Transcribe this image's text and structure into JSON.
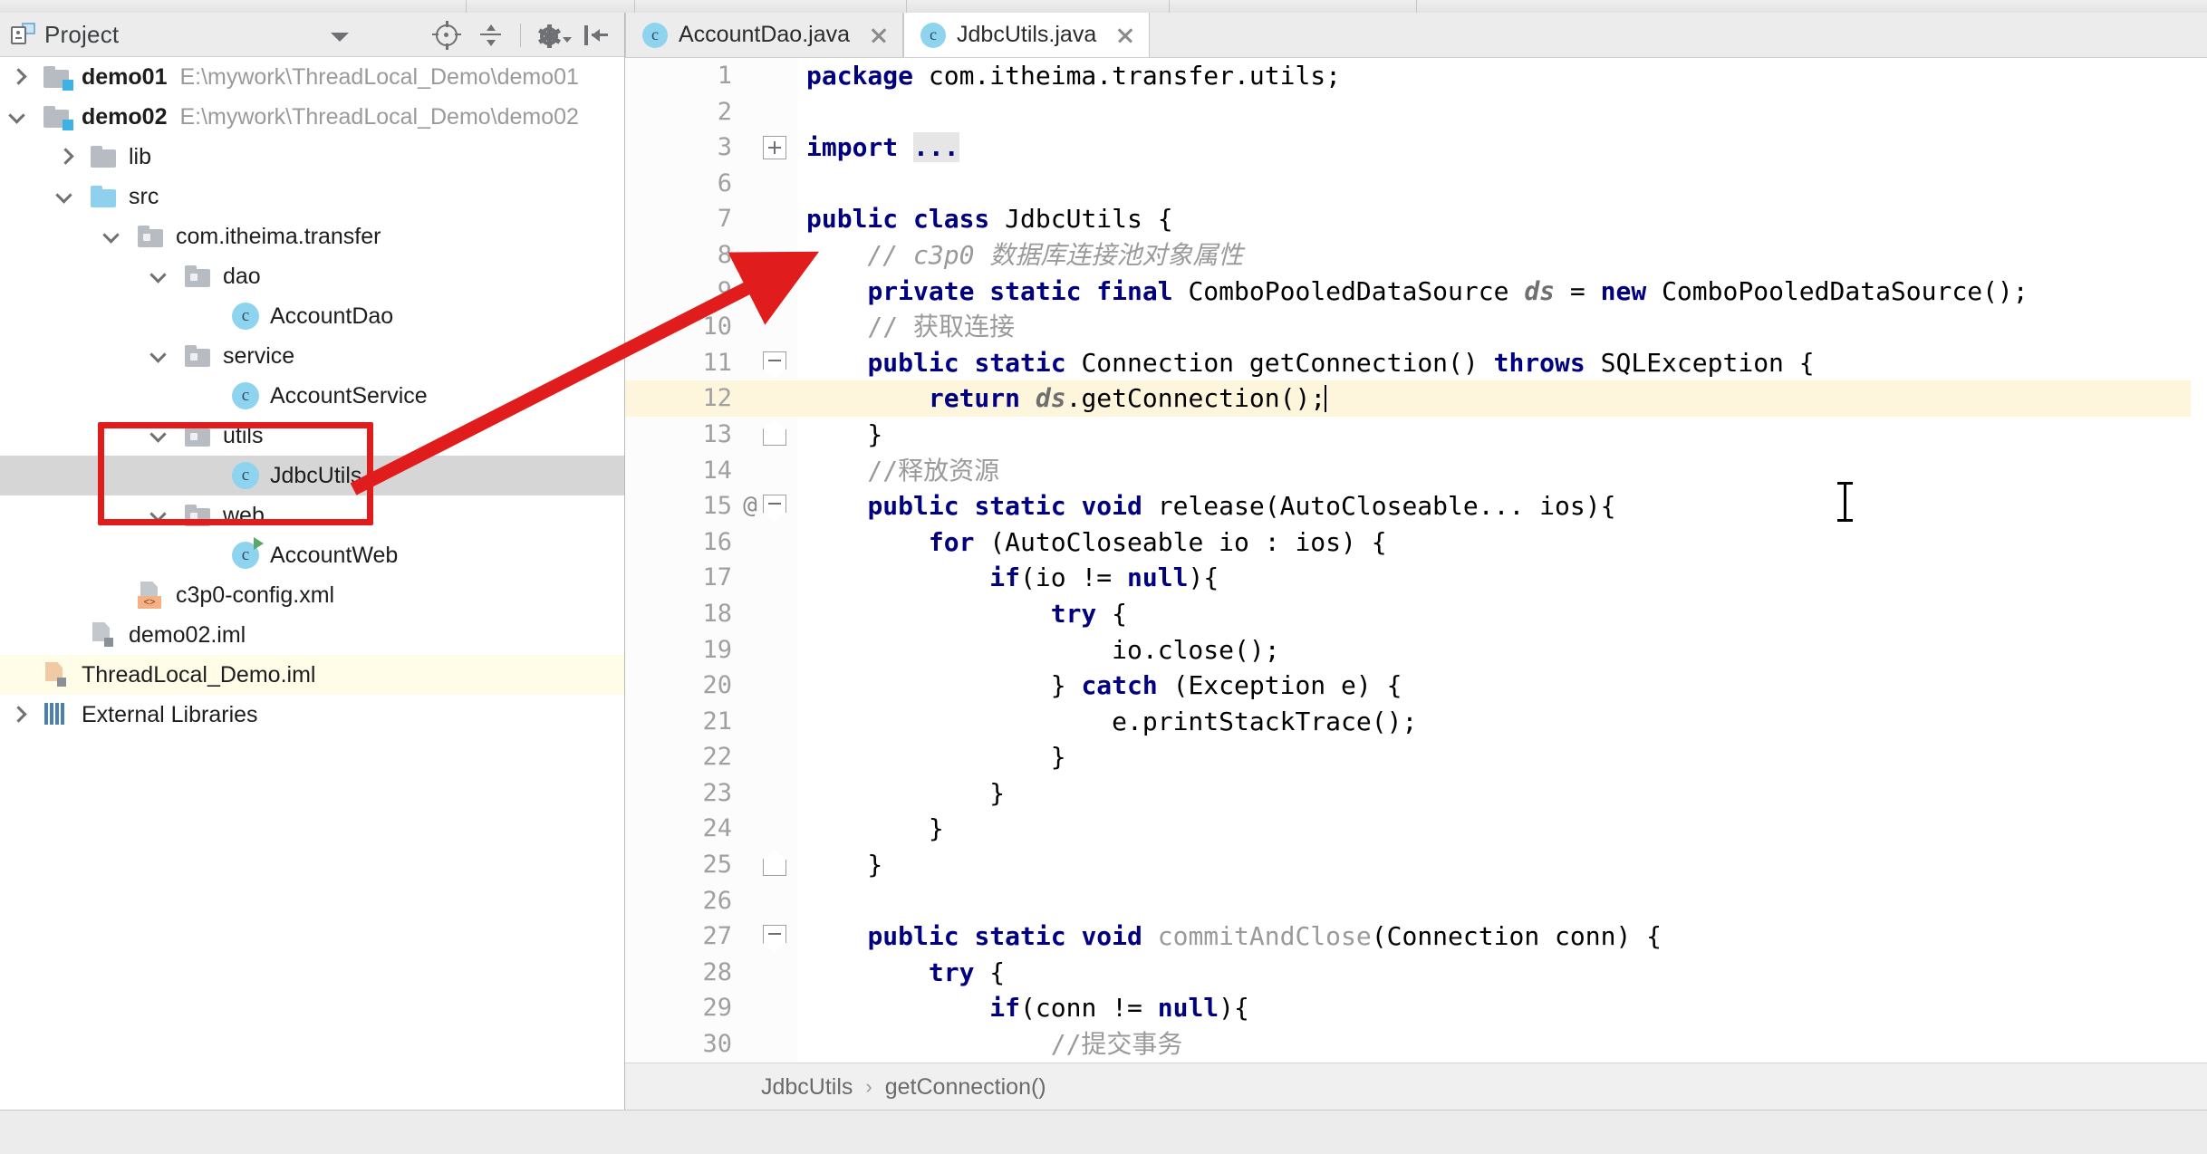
{
  "project_panel": {
    "title": "Project",
    "icons": [
      "project-icon",
      "dropdown-caret",
      "locate-icon",
      "collapse-all-icon",
      "settings-gear-icon",
      "hide-icon"
    ],
    "tree": [
      {
        "label": "demo01",
        "path": "E:\\mywork\\ThreadLocal_Demo\\demo01",
        "icon": "module-folder-icon",
        "arrow": "right",
        "indent": 0,
        "bold": true
      },
      {
        "label": "demo02",
        "path": "E:\\mywork\\ThreadLocal_Demo\\demo02",
        "icon": "module-folder-icon",
        "arrow": "down",
        "indent": 0,
        "bold": true
      },
      {
        "label": "lib",
        "path": "",
        "icon": "folder-icon",
        "arrow": "right",
        "indent": 1,
        "bold": false
      },
      {
        "label": "src",
        "path": "",
        "icon": "source-folder-icon",
        "arrow": "down",
        "indent": 1,
        "bold": false
      },
      {
        "label": "com.itheima.transfer",
        "path": "",
        "icon": "package-icon",
        "arrow": "down",
        "indent": 2,
        "bold": false
      },
      {
        "label": "dao",
        "path": "",
        "icon": "package-icon",
        "arrow": "down",
        "indent": 3,
        "bold": false
      },
      {
        "label": "AccountDao",
        "path": "",
        "icon": "java-class-icon",
        "arrow": "",
        "indent": 4,
        "bold": false
      },
      {
        "label": "service",
        "path": "",
        "icon": "package-icon",
        "arrow": "down",
        "indent": 3,
        "bold": false
      },
      {
        "label": "AccountService",
        "path": "",
        "icon": "java-class-icon",
        "arrow": "",
        "indent": 4,
        "bold": false
      },
      {
        "label": "utils",
        "path": "",
        "icon": "package-icon",
        "arrow": "down",
        "indent": 3,
        "bold": false
      },
      {
        "label": "JdbcUtils",
        "path": "",
        "icon": "java-class-icon",
        "arrow": "",
        "indent": 4,
        "bold": false,
        "selected": true
      },
      {
        "label": "web",
        "path": "",
        "icon": "package-icon",
        "arrow": "down",
        "indent": 3,
        "bold": false
      },
      {
        "label": "AccountWeb",
        "path": "",
        "icon": "java-runnable-class-icon",
        "arrow": "",
        "indent": 4,
        "bold": false
      },
      {
        "label": "c3p0-config.xml",
        "path": "",
        "icon": "xml-file-icon",
        "arrow": "",
        "indent": 2,
        "bold": false
      },
      {
        "label": "demo02.iml",
        "path": "",
        "icon": "iml-file-icon",
        "arrow": "",
        "indent": 1,
        "bold": false
      },
      {
        "label": "ThreadLocal_Demo.iml",
        "path": "",
        "icon": "iml-file-icon",
        "arrow": "",
        "indent": 0,
        "bold": false,
        "highlight": true
      },
      {
        "label": "External Libraries",
        "path": "",
        "icon": "libraries-icon",
        "arrow": "right",
        "indent": 0,
        "bold": false
      }
    ],
    "highlight_box_color": "#e01c1c"
  },
  "editor": {
    "tabs": [
      {
        "label": "AccountDao.java",
        "icon": "java-class-icon",
        "active": false,
        "close": "close-icon"
      },
      {
        "label": "JdbcUtils.java",
        "icon": "java-class-icon",
        "active": true,
        "close": "close-icon"
      }
    ],
    "breadcrumb": {
      "class_name": "JdbcUtils",
      "separator": "›",
      "member": "getConnection()"
    },
    "lines": [
      {
        "num": "1",
        "at": "",
        "fold": "",
        "hl": false,
        "tokens": [
          {
            "t": "package ",
            "c": "kw"
          },
          {
            "t": "com.itheima.transfer.utils;",
            "c": "plain"
          }
        ]
      },
      {
        "num": "2",
        "at": "",
        "fold": "",
        "hl": false,
        "tokens": []
      },
      {
        "num": "3",
        "at": "",
        "fold": "plus",
        "hl": false,
        "tokens": [
          {
            "t": "import ",
            "c": "kw"
          },
          {
            "t": "...",
            "c": "folded"
          }
        ]
      },
      {
        "num": "6",
        "at": "",
        "fold": "",
        "hl": false,
        "tokens": []
      },
      {
        "num": "7",
        "at": "",
        "fold": "",
        "hl": false,
        "tokens": [
          {
            "t": "public class ",
            "c": "kw"
          },
          {
            "t": "JdbcUtils {",
            "c": "plain"
          }
        ]
      },
      {
        "num": "8",
        "at": "",
        "fold": "",
        "hl": false,
        "tokens": [
          {
            "t": "    // c3p0 数据库连接池对象属性",
            "c": "cm"
          }
        ]
      },
      {
        "num": "9",
        "at": "",
        "fold": "",
        "hl": false,
        "tokens": [
          {
            "t": "    ",
            "c": "plain"
          },
          {
            "t": "private static final ",
            "c": "kw"
          },
          {
            "t": "ComboPooledDataSource ",
            "c": "plain"
          },
          {
            "t": "ds",
            "c": "fld2"
          },
          {
            "t": " = ",
            "c": "plain"
          },
          {
            "t": "new ",
            "c": "kw"
          },
          {
            "t": "ComboPooledDataSource();",
            "c": "plain"
          }
        ]
      },
      {
        "num": "10",
        "at": "",
        "fold": "",
        "hl": false,
        "tokens": [
          {
            "t": "    // 获取连接",
            "c": "cm2"
          }
        ]
      },
      {
        "num": "11",
        "at": "",
        "fold": "fstart",
        "hl": false,
        "tokens": [
          {
            "t": "    ",
            "c": "plain"
          },
          {
            "t": "public static ",
            "c": "kw"
          },
          {
            "t": "Connection getConnection() ",
            "c": "plain"
          },
          {
            "t": "throws ",
            "c": "kw"
          },
          {
            "t": "SQLException {",
            "c": "plain"
          }
        ]
      },
      {
        "num": "12",
        "at": "",
        "fold": "",
        "hl": true,
        "tokens": [
          {
            "t": "        ",
            "c": "plain"
          },
          {
            "t": "return ",
            "c": "kw"
          },
          {
            "t": "ds",
            "c": "fld2"
          },
          {
            "t": ".getConnection();",
            "c": "plain"
          }
        ]
      },
      {
        "num": "13",
        "at": "",
        "fold": "fend",
        "hl": false,
        "tokens": [
          {
            "t": "    }",
            "c": "plain"
          }
        ]
      },
      {
        "num": "14",
        "at": "",
        "fold": "",
        "hl": false,
        "tokens": [
          {
            "t": "    //释放资源",
            "c": "cm2"
          }
        ]
      },
      {
        "num": "15",
        "at": "@",
        "fold": "fstart",
        "hl": false,
        "tokens": [
          {
            "t": "    ",
            "c": "plain"
          },
          {
            "t": "public static void ",
            "c": "kw"
          },
          {
            "t": "release(AutoCloseable... ios){",
            "c": "plain"
          }
        ]
      },
      {
        "num": "16",
        "at": "",
        "fold": "",
        "hl": false,
        "tokens": [
          {
            "t": "        ",
            "c": "plain"
          },
          {
            "t": "for ",
            "c": "kw"
          },
          {
            "t": "(AutoCloseable io : ios) {",
            "c": "plain"
          }
        ]
      },
      {
        "num": "17",
        "at": "",
        "fold": "",
        "hl": false,
        "tokens": [
          {
            "t": "            ",
            "c": "plain"
          },
          {
            "t": "if",
            "c": "kw"
          },
          {
            "t": "(io != ",
            "c": "plain"
          },
          {
            "t": "null",
            "c": "kw"
          },
          {
            "t": "){",
            "c": "plain"
          }
        ]
      },
      {
        "num": "18",
        "at": "",
        "fold": "",
        "hl": false,
        "tokens": [
          {
            "t": "                ",
            "c": "plain"
          },
          {
            "t": "try ",
            "c": "kw"
          },
          {
            "t": "{",
            "c": "plain"
          }
        ]
      },
      {
        "num": "19",
        "at": "",
        "fold": "",
        "hl": false,
        "tokens": [
          {
            "t": "                    io.close();",
            "c": "plain"
          }
        ]
      },
      {
        "num": "20",
        "at": "",
        "fold": "",
        "hl": false,
        "tokens": [
          {
            "t": "                } ",
            "c": "plain"
          },
          {
            "t": "catch ",
            "c": "kw"
          },
          {
            "t": "(Exception e) {",
            "c": "plain"
          }
        ]
      },
      {
        "num": "21",
        "at": "",
        "fold": "",
        "hl": false,
        "tokens": [
          {
            "t": "                    e.printStackTrace();",
            "c": "plain"
          }
        ]
      },
      {
        "num": "22",
        "at": "",
        "fold": "",
        "hl": false,
        "tokens": [
          {
            "t": "                }",
            "c": "plain"
          }
        ]
      },
      {
        "num": "23",
        "at": "",
        "fold": "",
        "hl": false,
        "tokens": [
          {
            "t": "            }",
            "c": "plain"
          }
        ]
      },
      {
        "num": "24",
        "at": "",
        "fold": "",
        "hl": false,
        "tokens": [
          {
            "t": "        }",
            "c": "plain"
          }
        ]
      },
      {
        "num": "25",
        "at": "",
        "fold": "fend",
        "hl": false,
        "tokens": [
          {
            "t": "    }",
            "c": "plain"
          }
        ]
      },
      {
        "num": "26",
        "at": "",
        "fold": "",
        "hl": false,
        "tokens": []
      },
      {
        "num": "27",
        "at": "",
        "fold": "fstart",
        "hl": false,
        "tokens": [
          {
            "t": "    ",
            "c": "plain"
          },
          {
            "t": "public static void ",
            "c": "kw"
          },
          {
            "t": "commitAndClose",
            "c": "mth"
          },
          {
            "t": "(Connection conn) {",
            "c": "plain"
          }
        ]
      },
      {
        "num": "28",
        "at": "",
        "fold": "",
        "hl": false,
        "tokens": [
          {
            "t": "        ",
            "c": "plain"
          },
          {
            "t": "try ",
            "c": "kw"
          },
          {
            "t": "{",
            "c": "plain"
          }
        ]
      },
      {
        "num": "29",
        "at": "",
        "fold": "",
        "hl": false,
        "tokens": [
          {
            "t": "            ",
            "c": "plain"
          },
          {
            "t": "if",
            "c": "kw"
          },
          {
            "t": "(conn != ",
            "c": "plain"
          },
          {
            "t": "null",
            "c": "kw"
          },
          {
            "t": "){",
            "c": "plain"
          }
        ]
      },
      {
        "num": "30",
        "at": "",
        "fold": "",
        "hl": false,
        "tokens": [
          {
            "t": "                //提交事务",
            "c": "cm2"
          }
        ]
      }
    ]
  },
  "annotation": {
    "arrow_color": "#e01c1c",
    "type": "red-arrow-annotation"
  }
}
